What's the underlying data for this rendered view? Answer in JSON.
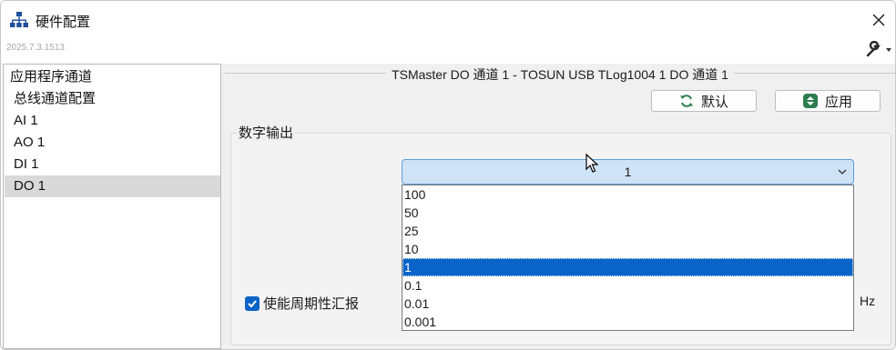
{
  "window": {
    "title": "硬件配置",
    "version": "2025.7.3.1513"
  },
  "sidebar": {
    "items": [
      {
        "label": "应用程序通道"
      },
      {
        "label": "总线通道配置"
      },
      {
        "label": "AI 1"
      },
      {
        "label": "AO 1"
      },
      {
        "label": "DI 1"
      },
      {
        "label": "DO 1"
      }
    ],
    "selected_index": 5
  },
  "main": {
    "header": "TSMaster DO 通道 1 - TOSUN USB TLog1004 1 DO 通道 1",
    "default_button": "默认",
    "apply_button": "应用",
    "group_title": "数字输出",
    "combo_value": "1",
    "options": [
      "100",
      "50",
      "25",
      "10",
      "1",
      "0.1",
      "0.01",
      "0.001"
    ],
    "selected_option_index": 4,
    "checkbox_label": "使能周期性汇报",
    "checkbox_checked": true,
    "unit_label": "Hz"
  },
  "icons": {
    "app": "hierarchy-icon",
    "close": "close-icon",
    "settings": "wrench-icon",
    "refresh": "refresh-icon",
    "apply": "up-down-icon",
    "dropdown": "chevron-down-icon",
    "check": "checkmark-icon"
  },
  "colors": {
    "selection": "#0a64c8",
    "combo_fill": "#cfe3f7",
    "apply_icon": "#2e7d4f",
    "refresh_icon": "#2e7d4f"
  }
}
